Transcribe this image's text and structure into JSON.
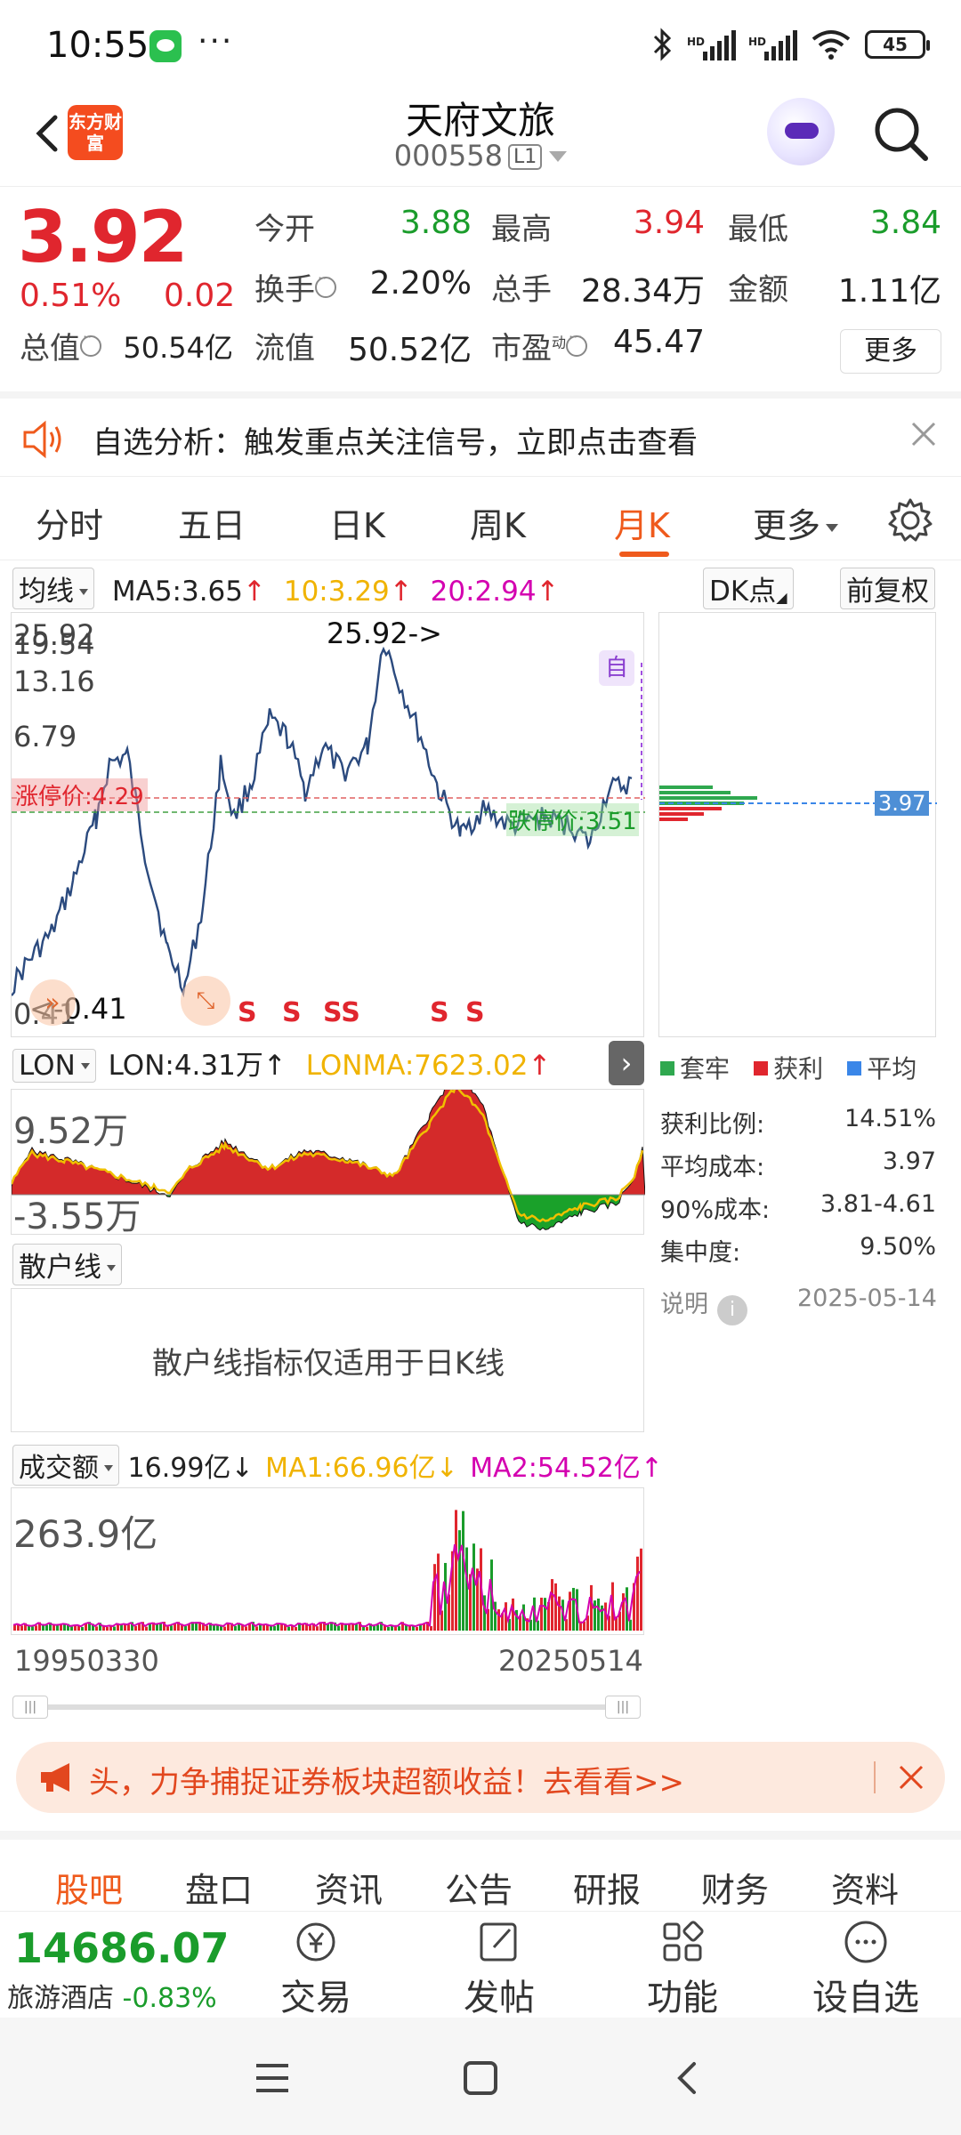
{
  "status": {
    "time": "10:55",
    "battery": "45"
  },
  "header": {
    "logo": "东方财富",
    "name": "天府文旅",
    "code": "000558",
    "level": "L1"
  },
  "quote": {
    "price": "3.92",
    "pct": "0.51%",
    "chg": "0.02",
    "open_label": "今开",
    "open": "3.88",
    "high_label": "最高",
    "high": "3.94",
    "low_label": "最低",
    "low": "3.84",
    "turnover_label": "换手",
    "turnover": "2.20%",
    "volume_label": "总手",
    "volume": "28.34万",
    "amount_label": "金额",
    "amount": "1.11亿",
    "mcap_label": "总值",
    "mcap": "50.54亿",
    "float_label": "流值",
    "float": "50.52亿",
    "pe_label": "市盈",
    "pe_sup": "动",
    "pe": "45.47",
    "more": "更多"
  },
  "banner": {
    "text": "自选分析：触发重点关注信号，立即点击查看"
  },
  "tabs": [
    "分时",
    "五日",
    "日K",
    "周K",
    "月K",
    "更多",
    "settings"
  ],
  "active_tab": "月K",
  "ma_row": {
    "select": "均线",
    "ma5": "MA5:3.65",
    "ma10": "10:3.29",
    "ma20": "20:2.94",
    "dk": "DK点",
    "adj": "前复权"
  },
  "kchart": {
    "y_labels": [
      "25.92",
      "19.54",
      "13.16",
      "6.79",
      "0.41"
    ],
    "high_note": "25.92->",
    "low_note": "<-0.41",
    "limit_up_left": "涨停价:4.29",
    "limit_up_right": "跌停价:3.51",
    "zi_badge": "自",
    "s_marks": [
      "S",
      "S",
      "SS",
      "S",
      "S"
    ],
    "chip_price": "3.97"
  },
  "lon_row": {
    "select": "LON",
    "lon": "LON:4.31万",
    "lonma": "LONMA:7623.02",
    "max": "9.52万",
    "min": "-3.55万"
  },
  "retail_row": {
    "select": "散户线",
    "message": "散户线指标仅适用于日K线"
  },
  "vol_row": {
    "select": "成交额",
    "amt": "16.99亿",
    "ma1": "MA1:66.96亿",
    "ma2": "MA2:54.52亿",
    "max": "263.9亿",
    "start": "19950330",
    "end": "20250514"
  },
  "chips": {
    "legend": [
      "套牢",
      "获利",
      "平均"
    ],
    "legend_colors": [
      "#2fa84f",
      "#e0262e",
      "#3a86e8"
    ],
    "rows": [
      {
        "label": "获利比例:",
        "value": "14.51%"
      },
      {
        "label": "平均成本:",
        "value": "3.97"
      },
      {
        "label": "90%成本:",
        "value": "3.81-4.61"
      },
      {
        "label": "集中度:",
        "value": "9.50%"
      }
    ],
    "note_label": "说明",
    "date": "2025-05-14"
  },
  "promo": {
    "text": "头，力争捕捉证券板块超额收益！去看看>>"
  },
  "sub_tabs": [
    "股吧",
    "盘口",
    "资讯",
    "公告",
    "研报",
    "财务",
    "资料"
  ],
  "bottom": {
    "index_value": "14686.07",
    "index_name": "旅游酒店",
    "index_chg": "-0.83%",
    "actions": [
      "交易",
      "发帖",
      "功能",
      "设自选"
    ]
  },
  "colors": {
    "up": "#e0262e",
    "down": "#1a9c2b",
    "accent": "#ef5a1c",
    "price_line": "#2b4a7e"
  }
}
